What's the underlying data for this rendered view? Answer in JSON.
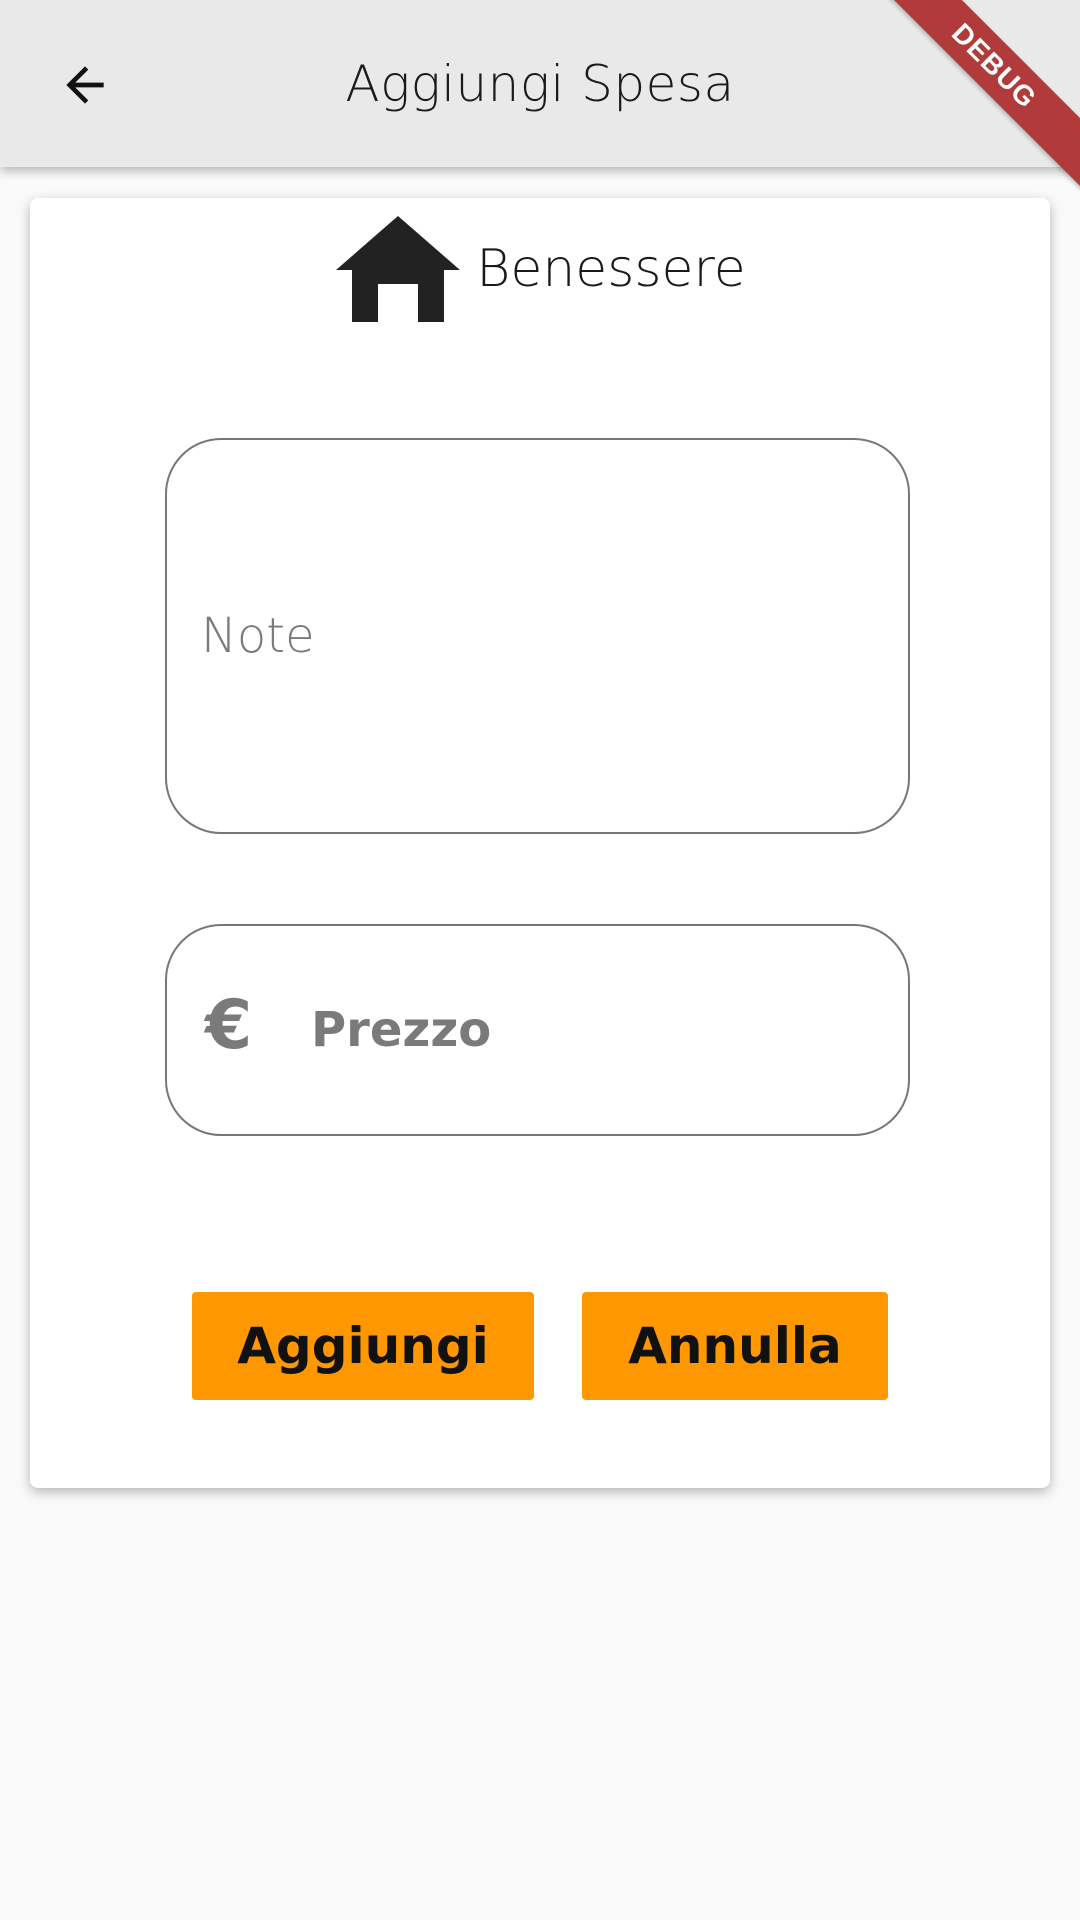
{
  "appbar": {
    "title": "Aggiungi Spesa",
    "back_icon": "arrow-left-icon"
  },
  "debug_banner": "DEBUG",
  "category": {
    "icon": "home-icon",
    "label": "Benessere"
  },
  "form": {
    "note": {
      "placeholder": "Note",
      "value": ""
    },
    "price": {
      "icon": "euro-icon",
      "placeholder": "Prezzo",
      "value": ""
    }
  },
  "actions": {
    "add_label": "Aggiungi",
    "cancel_label": "Annulla"
  },
  "colors": {
    "accent": "#ff9800",
    "appbar_bg": "#e9e9e9",
    "debug_banner": "#b13a3a"
  }
}
